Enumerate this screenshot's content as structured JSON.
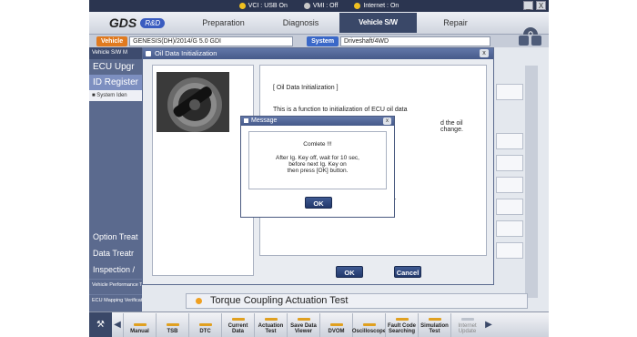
{
  "status": {
    "vci": "VCI : USB On",
    "vmi": "VMI : Off",
    "internet": "Internet : On"
  },
  "window_controls": {
    "minimize": "_",
    "close": "X"
  },
  "logo": {
    "brand": "GDS",
    "badge": "R&D"
  },
  "tabs": [
    {
      "label": "Preparation",
      "active": false
    },
    {
      "label": "Diagnosis",
      "active": false
    },
    {
      "label": "Vehicle S/W Management",
      "active": true
    },
    {
      "label": "Repair",
      "active": false
    }
  ],
  "vehicle_bar": {
    "vehicle_label": "Vehicle",
    "vehicle_value": "GENESIS(DH)/2014/G 5.0 GDI",
    "system_label": "System",
    "system_value": "Driveshaft/4WD"
  },
  "sidebar": {
    "header": "Vehicle S/W M",
    "items": [
      {
        "label": "ECU Upgr"
      },
      {
        "label": "ID Register"
      }
    ],
    "sub_item": "System Iden",
    "lower_items": [
      {
        "label": "Option Treat"
      },
      {
        "label": "Data Treatr"
      },
      {
        "label": "Inspection /"
      }
    ],
    "small_items": [
      {
        "label": "Vehicle Performance Test"
      },
      {
        "label": "ECU Mapping Verification"
      }
    ]
  },
  "main": {
    "torque_label": "Torque Coupling Actuation Test"
  },
  "oil_dialog": {
    "title": "Oil Data Initialization",
    "close": "x",
    "heading": "[ Oil Data Initialization ]",
    "line1": "This is a function to initialization of ECU oil data",
    "line2": "d the oil change.",
    "line3": "on.",
    "ok": "OK",
    "cancel": "Cancel"
  },
  "message_dialog": {
    "title": "Message",
    "close": "x",
    "line1": "Comlete !!!",
    "line2": "After Ig. Key off, wait for 10 sec,",
    "line3": "before next Ig. Key on",
    "line4": "then press [OK] button.",
    "ok": "OK"
  },
  "bottom_toolbar": {
    "home_label": "⚒",
    "items": [
      {
        "label": "Manual",
        "enabled": true
      },
      {
        "label": "TSB",
        "enabled": true
      },
      {
        "label": "DTC",
        "enabled": true
      },
      {
        "label": "Current Data",
        "enabled": true
      },
      {
        "label": "Actuation Test",
        "enabled": true
      },
      {
        "label": "Save Data Viewer",
        "enabled": true
      },
      {
        "label": "DVOM",
        "enabled": true
      },
      {
        "label": "Oscilloscope",
        "enabled": true
      },
      {
        "label": "Fault Code Searching",
        "enabled": true
      },
      {
        "label": "Simulation Test",
        "enabled": true
      },
      {
        "label": "Internet Update",
        "enabled": false
      }
    ]
  },
  "colors": {
    "accent": "#3a4868",
    "title_bar": "#465a8a",
    "vehicle_chip": "#e07a1f",
    "system_chip": "#3a68c8"
  }
}
